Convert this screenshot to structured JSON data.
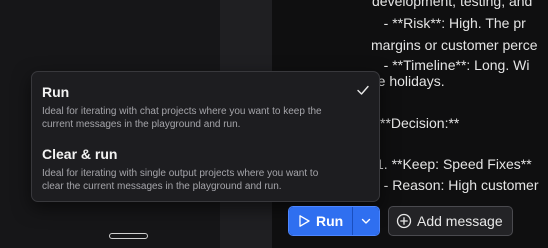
{
  "content": {
    "lines": [
      "development, testing, and",
      "   - **Risk**: High. The pr",
      "margins or customer perce",
      "   - **Timeline**: Long. Wi",
      "the holidays.",
      "",
      "**Decision:**",
      "",
      "1. **Keep: Speed Fixes**",
      "   - Reason: High customer"
    ]
  },
  "menu": {
    "items": [
      {
        "title": "Run",
        "selected": true,
        "description_lines": [
          "Ideal for iterating with chat projects where you want to keep the",
          "current messages in the playground and run."
        ]
      },
      {
        "title": "Clear & run",
        "selected": false,
        "description_lines": [
          "Ideal for iterating with single output projects where you want to",
          "clear the current messages in the playground and run."
        ]
      }
    ],
    "check_icon": "checkmark-icon"
  },
  "toolbar": {
    "run_label": "Run",
    "run_icon": "play-icon",
    "dropdown_icon": "chevron-down-icon",
    "add_message_label": "Add message",
    "add_message_icon": "plus-circle-icon",
    "accent_color": "#2f6ff0"
  }
}
